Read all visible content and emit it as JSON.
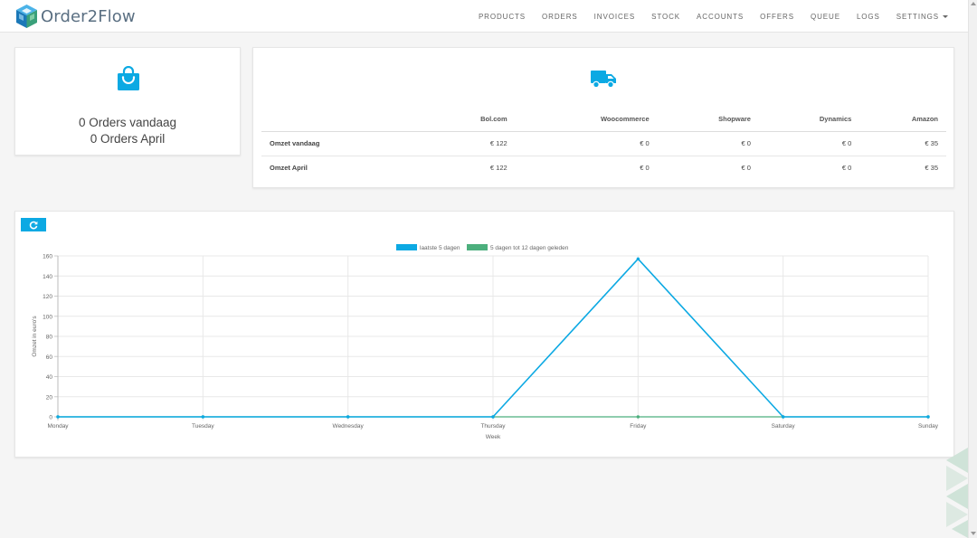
{
  "brand": {
    "name": "Order2Flow"
  },
  "nav": {
    "items": [
      "PRODUCTS",
      "ORDERS",
      "INVOICES",
      "STOCK",
      "ACCOUNTS",
      "OFFERS",
      "QUEUE",
      "LOGS"
    ],
    "settings_label": "SETTINGS"
  },
  "orders": {
    "today": "0 Orders vandaag",
    "month": "0 Orders April"
  },
  "revenue": {
    "columns": [
      "",
      "Bol.com",
      "Woocommerce",
      "Shopware",
      "Dynamics",
      "Amazon"
    ],
    "rows": [
      {
        "label": "Omzet vandaag",
        "values": [
          "€ 122",
          "€ 0",
          "€ 0",
          "€ 0",
          "€ 35"
        ]
      },
      {
        "label": "Omzet April",
        "values": [
          "€ 122",
          "€ 0",
          "€ 0",
          "€ 0",
          "€ 35"
        ]
      }
    ]
  },
  "colors": {
    "accent": "#0ca9e3",
    "green": "#4caf7d"
  },
  "chart_data": {
    "type": "line",
    "categories": [
      "Monday",
      "Tuesday",
      "Wednesday",
      "Thursday",
      "Friday",
      "Saturday",
      "Sunday"
    ],
    "series": [
      {
        "name": "laatste 5 dagen",
        "color": "#0ca9e3",
        "values": [
          0,
          0,
          0,
          0,
          157,
          0,
          0
        ]
      },
      {
        "name": "5 dagen tot 12 dagen geleden",
        "color": "#4caf7d",
        "values": [
          0,
          0,
          0,
          0,
          0,
          0,
          0
        ]
      }
    ],
    "xlabel": "Week",
    "ylabel": "Omzet in euro's",
    "ylim": [
      0,
      160
    ],
    "yticks": [
      0,
      20,
      40,
      60,
      80,
      100,
      120,
      140,
      160
    ],
    "grid": true,
    "legend": "top"
  }
}
